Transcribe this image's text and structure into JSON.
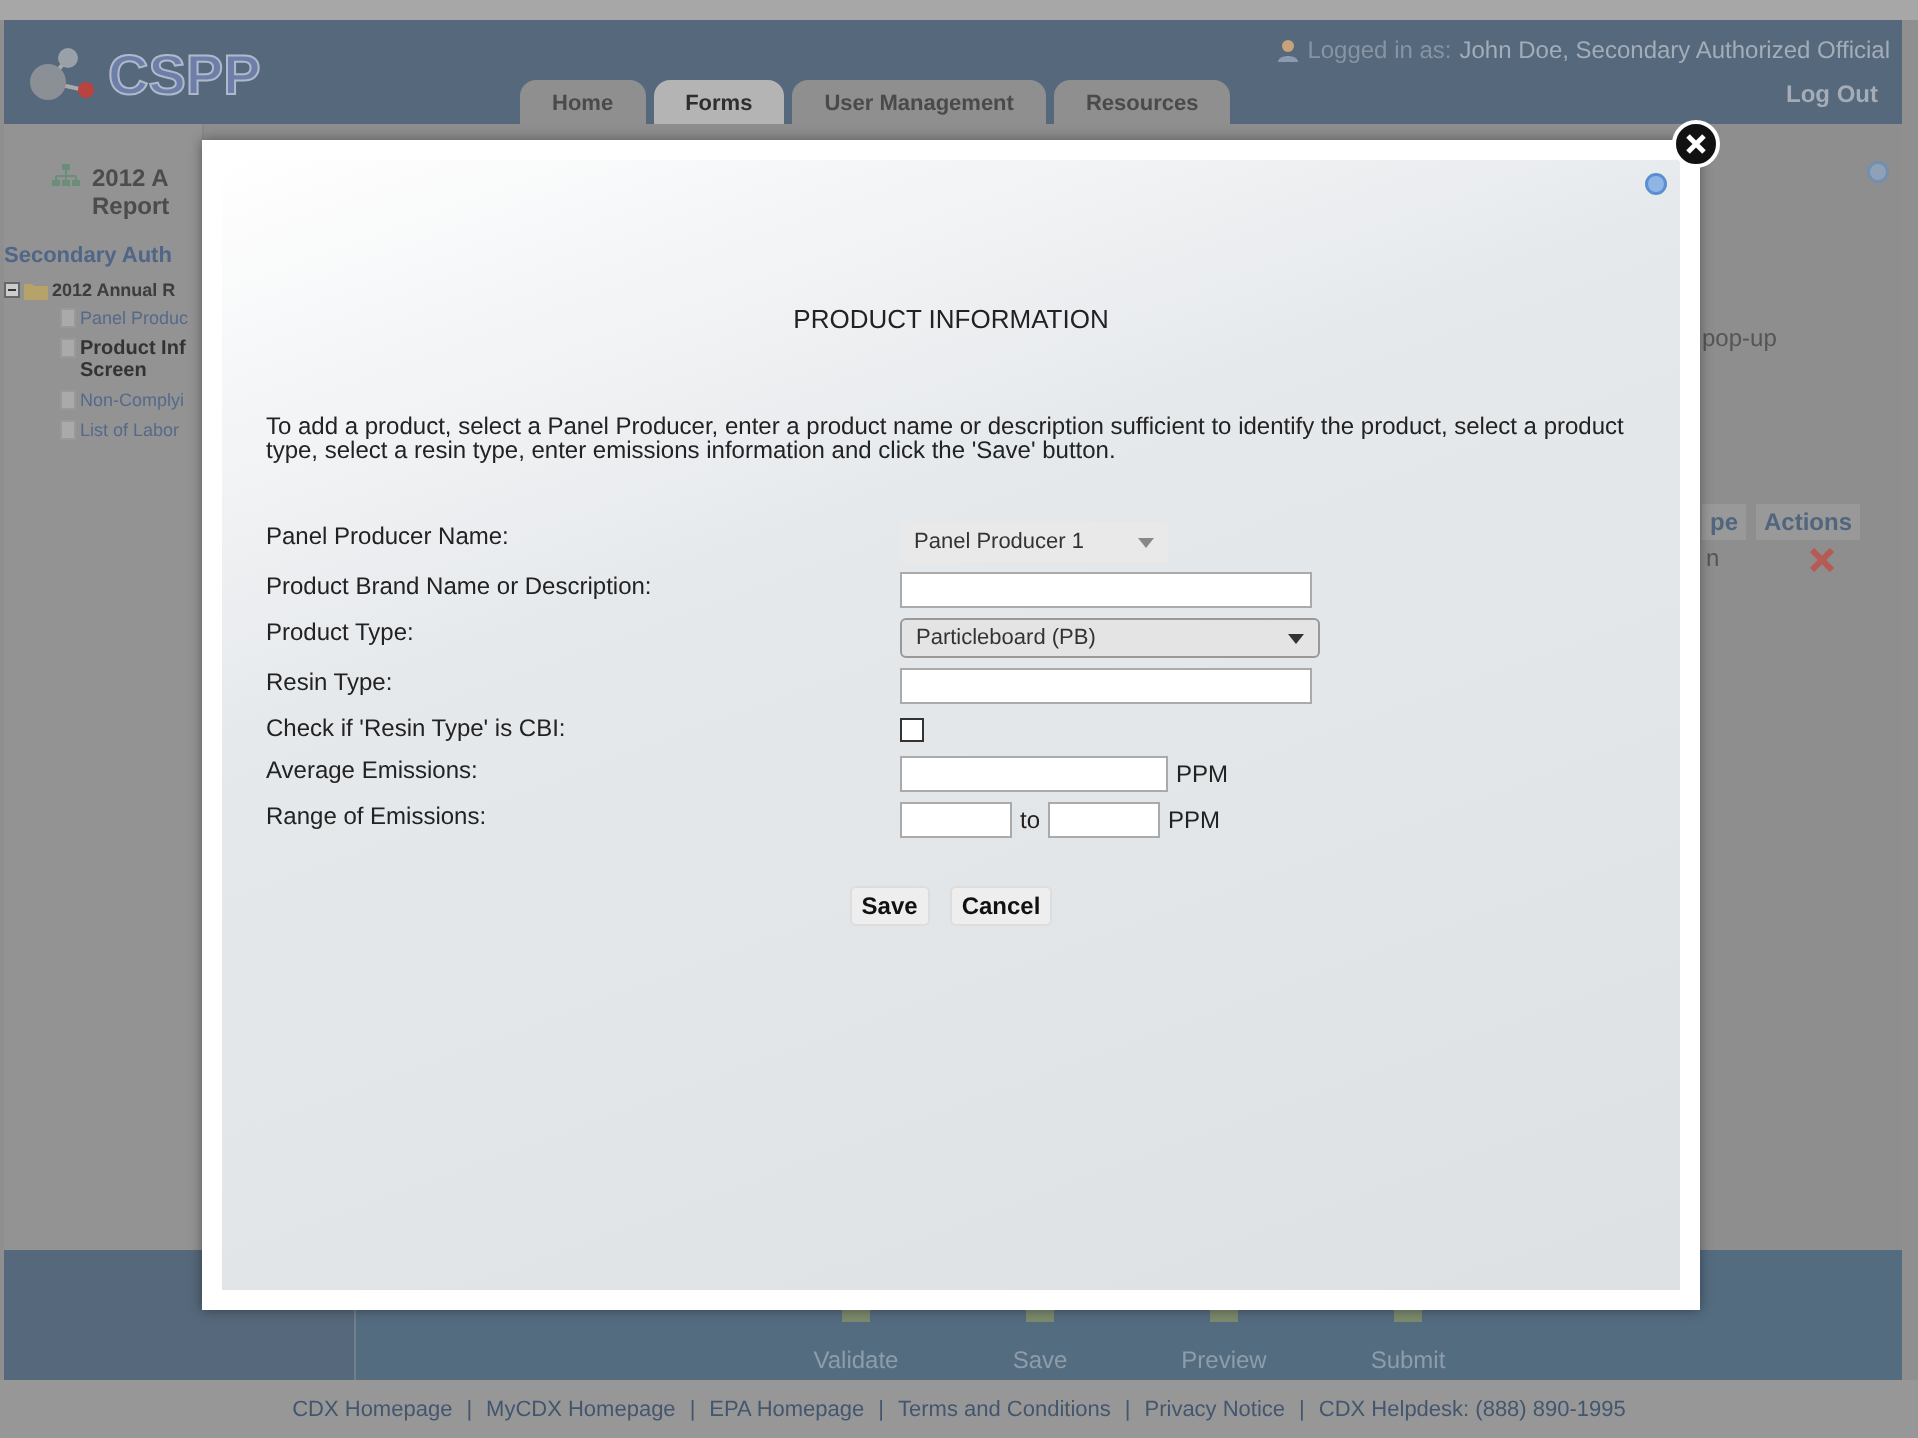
{
  "header": {
    "logo": "CSPP",
    "logged_in_label": "Logged in as:",
    "user": "John Doe, Secondary Authorized Official",
    "logout": "Log Out",
    "tabs": [
      {
        "label": "Home",
        "selected": false
      },
      {
        "label": "Forms",
        "selected": true
      },
      {
        "label": "User Management",
        "selected": false
      },
      {
        "label": "Resources",
        "selected": false
      }
    ]
  },
  "sidebar": {
    "title_lines": [
      "2012 A",
      "Report"
    ],
    "subtitle": "Secondary Auth",
    "tree": [
      {
        "label": "2012 Annual R",
        "expanded": true,
        "children": [
          {
            "label": "Panel Produc",
            "selected": false
          },
          {
            "label": "Product Inf Screen",
            "selected": true
          },
          {
            "label": "Non-Complyi",
            "selected": false
          },
          {
            "label": "List of Labor",
            "selected": false
          }
        ]
      }
    ]
  },
  "main": {
    "note": "pop-up",
    "table": {
      "columns": [
        "pe",
        "Actions"
      ],
      "rows": [
        {
          "column_1": "n"
        }
      ]
    }
  },
  "toolbar": [
    "Validate",
    "Save",
    "Preview",
    "Submit"
  ],
  "footer_separator": "|",
  "footer_links": [
    "CDX Homepage",
    "MyCDX Homepage",
    "EPA Homepage",
    "Terms and Conditions",
    "Privacy Notice",
    "CDX Helpdesk: (888) 890-1995"
  ],
  "dialog": {
    "title": "PRODUCT INFORMATION",
    "instructions": "To add a product, select a Panel Producer, enter a product name or description sufficient to identify the product, select a product type, select a resin type, enter emissions information and click the 'Save' button.",
    "fields": [
      {
        "kind": "select",
        "label": "Panel Producer Name:",
        "value": "Panel Producer 1"
      },
      {
        "kind": "text",
        "label": "Product Brand Name or Description:"
      },
      {
        "kind": "wide_select",
        "label": "Product Type:",
        "value": "Particleboard (PB)"
      },
      {
        "kind": "text",
        "label": "Resin Type:"
      },
      {
        "kind": "checkbox",
        "label": "Check if 'Resin Type' is CBI:",
        "checked": false
      },
      {
        "kind": "unit",
        "label": "Average Emissions:",
        "unit": "PPM"
      },
      {
        "kind": "range",
        "label": "Range of Emissions:",
        "joiner": "to",
        "unit": "PPM"
      }
    ],
    "buttons": [
      "Save",
      "Cancel"
    ]
  }
}
